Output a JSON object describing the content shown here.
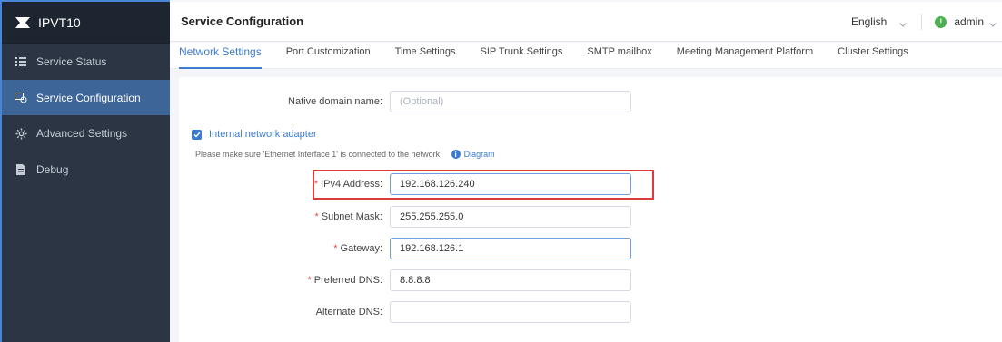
{
  "brand": {
    "name": "IPVT10"
  },
  "sidebar": {
    "items": [
      {
        "label": "Service Status",
        "icon": "list-icon"
      },
      {
        "label": "Service Configuration",
        "icon": "config-icon",
        "active": true
      },
      {
        "label": "Advanced Settings",
        "icon": "gear-icon"
      },
      {
        "label": "Debug",
        "icon": "document-icon"
      }
    ]
  },
  "header": {
    "title": "Service Configuration",
    "language": "English",
    "user": "admin"
  },
  "tabs": [
    {
      "label": "Network Settings",
      "active": true
    },
    {
      "label": "Port Customization"
    },
    {
      "label": "Time Settings"
    },
    {
      "label": "SIP Trunk Settings"
    },
    {
      "label": "SMTP mailbox"
    },
    {
      "label": "Meeting Management Platform"
    },
    {
      "label": "Cluster Settings"
    }
  ],
  "form": {
    "native_domain": {
      "label": "Native domain name:",
      "placeholder": "(Optional)"
    },
    "internal_adapter": {
      "label": "Internal network adapter",
      "checked": true
    },
    "note": {
      "text": "Please make sure 'Ethernet Interface 1' is connected to the network.",
      "link": "Diagram"
    },
    "ipv4": {
      "label": "IPv4 Address:",
      "value": "192.168.126.240",
      "required": true
    },
    "subnet": {
      "label": "Subnet Mask:",
      "value": "255.255.255.0",
      "required": true
    },
    "gateway": {
      "label": "Gateway:",
      "value": "192.168.126.1",
      "required": true
    },
    "preferred_dns": {
      "label": "Preferred DNS:",
      "value": "8.8.8.8",
      "required": true
    },
    "alternate_dns": {
      "label": "Alternate DNS:",
      "value": ""
    },
    "required_mark": "*"
  },
  "colors": {
    "accent": "#3b7bd0",
    "sidebar_bg": "#2b3544",
    "active_nav": "#3d6598",
    "highlight": "#e03b3b"
  }
}
